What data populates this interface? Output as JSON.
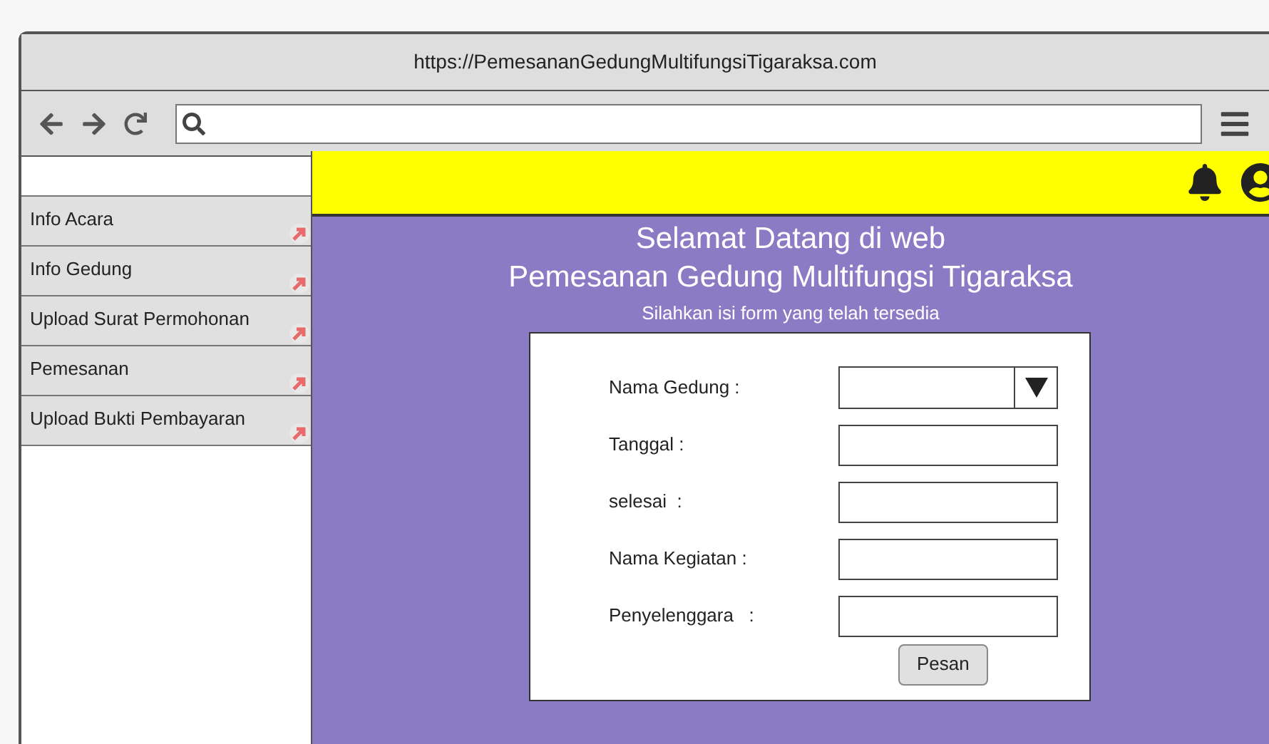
{
  "browser": {
    "url": "https://PemesananGedungMultifungsiTigaraksa.com"
  },
  "sidebar": {
    "items": [
      {
        "label": "Info Acara"
      },
      {
        "label": "Info Gedung"
      },
      {
        "label": "Upload Surat Permohonan"
      },
      {
        "label": "Pemesanan"
      },
      {
        "label": "Upload Bukti Pembayaran"
      }
    ]
  },
  "header": {
    "title_lines": [
      "Selamat Datang di web",
      "Pemesanan Gedung Multifungsi Tigaraksa"
    ],
    "subtitle": "Silahkan isi form yang telah tersedia"
  },
  "form": {
    "fields": [
      {
        "label": "Nama Gedung :",
        "kind": "dropdown"
      },
      {
        "label": "Tanggal :",
        "kind": "text"
      },
      {
        "label": "selesai  :",
        "kind": "text"
      },
      {
        "label": "Nama Kegiatan :",
        "kind": "text"
      },
      {
        "label": "Penyelenggara   :",
        "kind": "text"
      }
    ],
    "submit": "Pesan"
  }
}
